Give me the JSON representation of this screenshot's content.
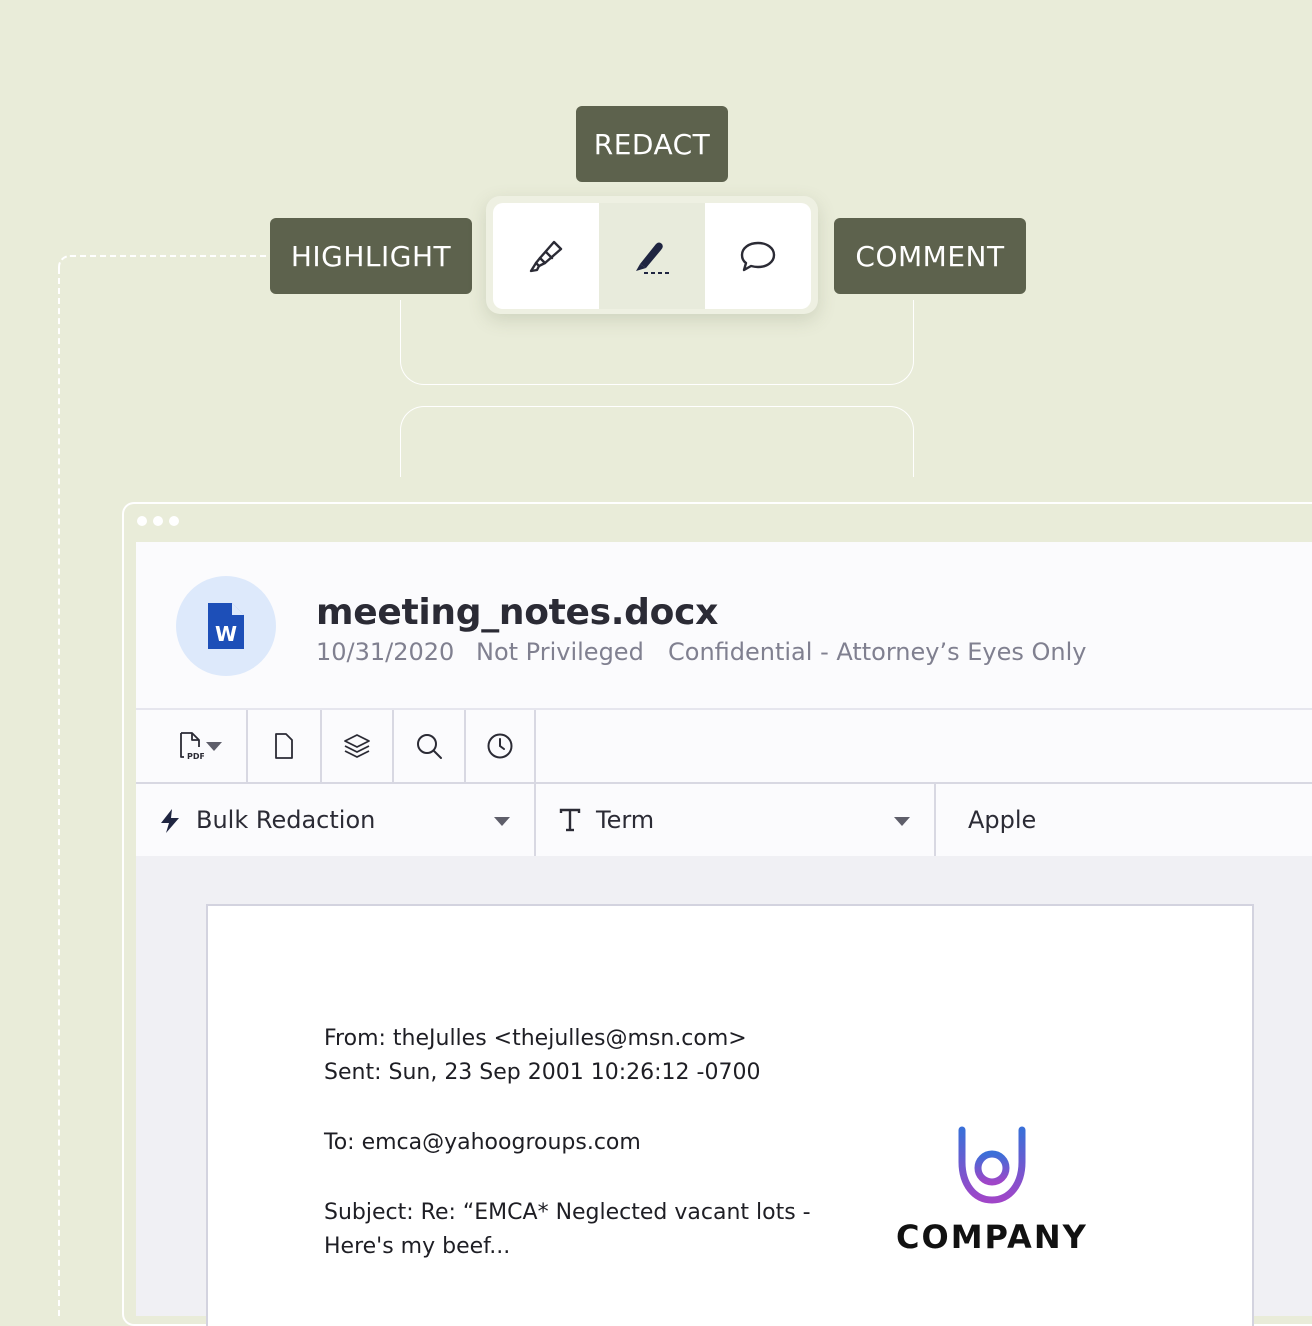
{
  "tooltips": {
    "redact": "REDACT",
    "highlight": "HIGHLIGHT",
    "comment": "COMMENT"
  },
  "tools": [
    {
      "name": "highlighter",
      "icon": "highlighter-icon"
    },
    {
      "name": "redact",
      "icon": "redact-pen-icon",
      "active": true
    },
    {
      "name": "comment",
      "icon": "speech-bubble-icon"
    }
  ],
  "document": {
    "filename": "meeting_notes.docx",
    "date": "10/31/2020",
    "privilege": "Not Privileged",
    "confidentiality": "Confidential - Attorney’s Eyes Only",
    "file_icon": "word-doc-icon",
    "file_icon_letter": "W"
  },
  "iconbar": [
    "pdf-export-icon",
    "page-icon",
    "layers-icon",
    "search-icon",
    "history-clock-icon"
  ],
  "filters": {
    "mode": "Bulk Redaction",
    "type": "Term",
    "value": "Apple"
  },
  "email": {
    "from": "From: theJulles <thejulles@msn.com>",
    "sent": "Sent: Sun, 23 Sep 2001 10:26:12 -0700",
    "to": "To: emca@yahoogroups.com",
    "subject_line1": "Subject: Re: “EMCA* Neglected vacant lots -",
    "subject_line2": "Here's my beef..."
  },
  "logo": {
    "text": "COMPANY",
    "colors": {
      "top": "#3b6fd8",
      "bottom": "#a046c8"
    }
  },
  "colors": {
    "background": "#e9ecd9",
    "tooltip": "#5d624d",
    "avatar_bg": "#dde9fb",
    "word_blue": "#1d4fb8"
  }
}
